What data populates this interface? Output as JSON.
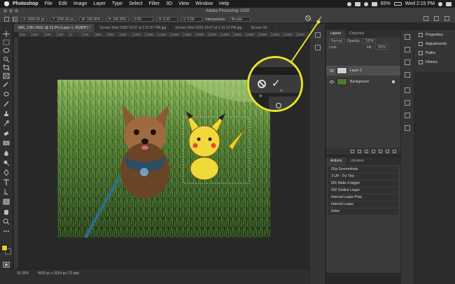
{
  "menubar": {
    "app": "Photoshop",
    "items": [
      "File",
      "Edit",
      "Image",
      "Layer",
      "Type",
      "Select",
      "Filter",
      "3D",
      "View",
      "Window",
      "Help"
    ],
    "battery": "65%",
    "clock": "Wed 2:15 PM"
  },
  "window": {
    "title": "Adobe Photoshop 2020"
  },
  "options": {
    "x": "X: 3006.00 px",
    "y": "Y: 1296.00 px",
    "w": "W: 100.00%",
    "h": "H: 100.00%",
    "angle": "0.00",
    "hskew": "H: 0.00",
    "vskew": "V: 0.00",
    "interpolation_label": "Interpolation:",
    "interpolation_value": "Bicubic"
  },
  "tabs": [
    "IMG_1991.HEIC @ 33.3% (Layer 1, RGB/8*) *",
    "Screen Shot 2020-10-07 at 2.07.57 PM.jpg",
    "Screen Shot 2020-10-07 at 2.10.12 PM.jpg",
    "Screen Sh"
  ],
  "ruler": [
    "800",
    "600",
    "400",
    "200",
    "0",
    "200",
    "400",
    "600",
    "800",
    "1000",
    "1200",
    "1400",
    "1600",
    "1800",
    "2000",
    "2200",
    "2400",
    "2600",
    "2800",
    "3000",
    "3200",
    "3400",
    "3600"
  ],
  "status": {
    "zoom": "33.33%",
    "dims": "4032 px x 3024 px (72 ppi)"
  },
  "layers_panel": {
    "tabs": [
      "Layers",
      "Channels"
    ],
    "blend_mode": "Normal",
    "opacity_label": "Opacity:",
    "opacity": "100%",
    "lock_label": "Lock:",
    "fill_label": "Fill:",
    "fill": "100%",
    "layers": [
      {
        "name": "Layer 1"
      },
      {
        "name": "Background"
      }
    ]
  },
  "actions_panel": {
    "tabs": [
      "Actions",
      "Libraries"
    ],
    "items": [
      "2Up Screenshots",
      "3 UP - Try This",
      "001 Make it bigger",
      "002 Outline Loupe",
      "Internal Loupe Prep",
      "Internal Loupe",
      "Index"
    ]
  },
  "properties_panel": {
    "items": [
      "Properties",
      "Adjustments",
      "Paths",
      "History"
    ]
  },
  "colors": {
    "callout": "#e8e22a",
    "foreground": "#e8d21e"
  }
}
